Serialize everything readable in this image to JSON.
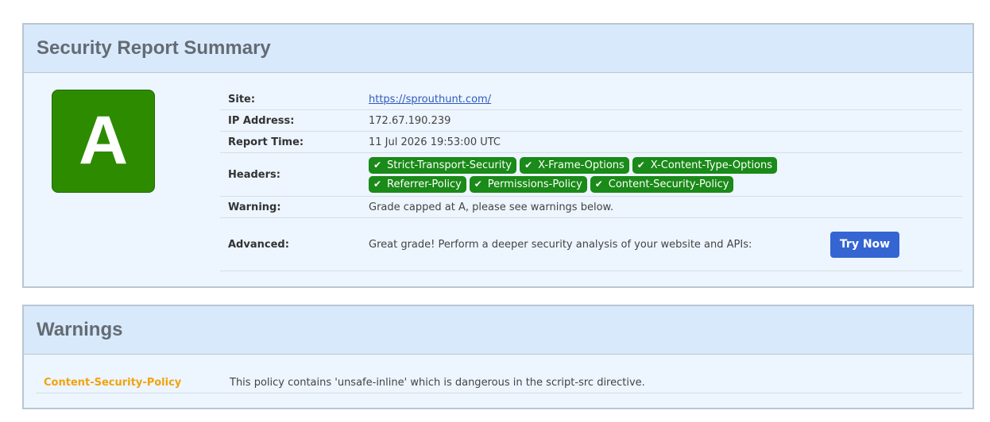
{
  "summary": {
    "title": "Security Report Summary",
    "grade": "A",
    "grade_color": "#2d8b00",
    "rows": {
      "site_label": "Site:",
      "site_value": "https://sprouthunt.com/",
      "ip_label": "IP Address:",
      "ip_value": "172.67.190.239",
      "time_label": "Report Time:",
      "time_value": "11 Jul 2026 19:53:00 UTC",
      "headers_label": "Headers:",
      "warning_label": "Warning:",
      "warning_value": "Grade capped at A, please see warnings below.",
      "advanced_label": "Advanced:",
      "advanced_value": "Great grade! Perform a deeper security analysis of your website and APIs:",
      "advanced_button": "Try Now"
    },
    "headers": [
      {
        "label": "Strict-Transport-Security",
        "icon": "check-icon"
      },
      {
        "label": "X-Frame-Options",
        "icon": "check-icon"
      },
      {
        "label": "X-Content-Type-Options",
        "icon": "check-icon"
      },
      {
        "label": "Referrer-Policy",
        "icon": "check-icon"
      },
      {
        "label": "Permissions-Policy",
        "icon": "check-icon"
      },
      {
        "label": "Content-Security-Policy",
        "icon": "check-icon"
      }
    ],
    "badge_color": "#1a8a18"
  },
  "warnings": {
    "title": "Warnings",
    "items": [
      {
        "name": "Content-Security-Policy",
        "description": "This policy contains 'unsafe-inline' which is dangerous in the script-src directive."
      }
    ],
    "name_color": "#f2a30b"
  }
}
